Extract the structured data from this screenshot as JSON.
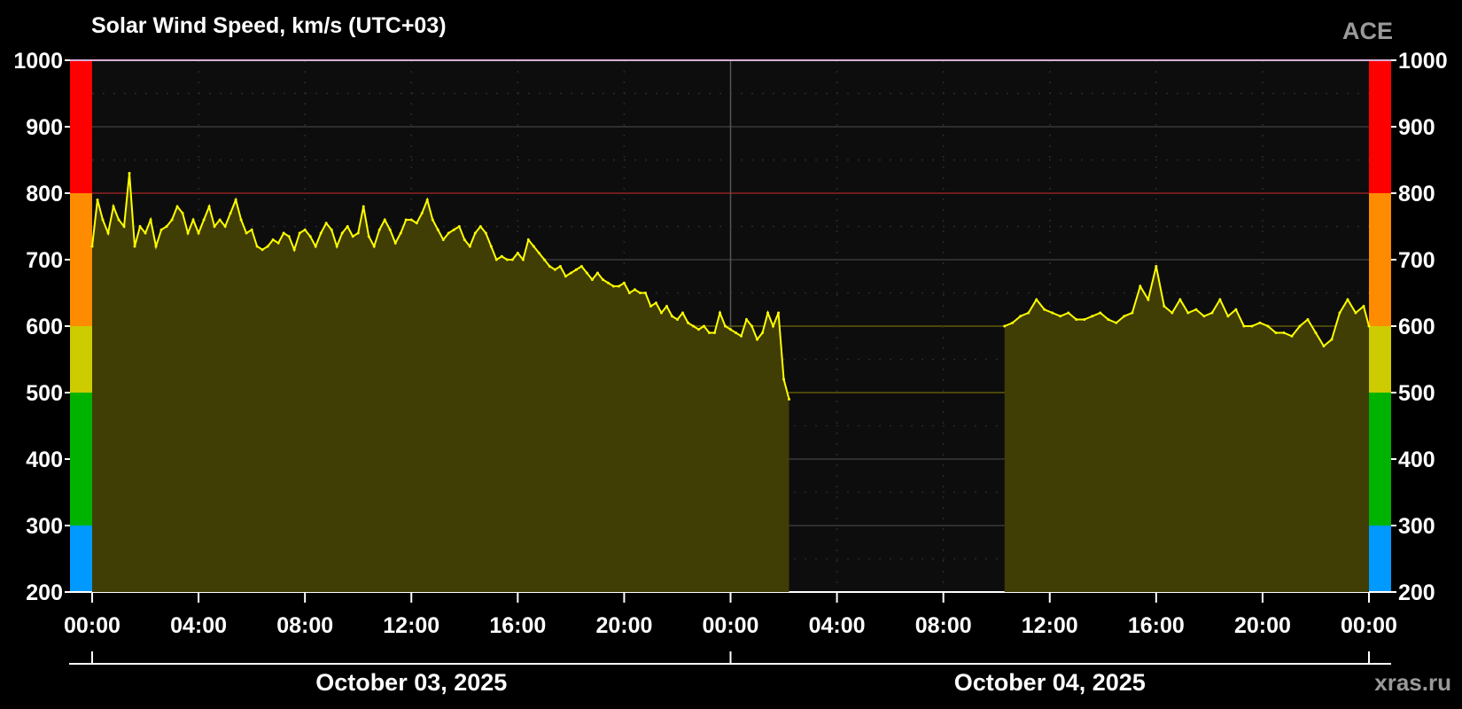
{
  "title": "Solar Wind Speed, km/s (UTC+03)",
  "source_label": "ACE",
  "watermark": "xras.ru",
  "colors": {
    "background": "#000000",
    "plot_bg": "#0d0d0d",
    "grid": "#3a3a3a",
    "line": "#ffff00",
    "fill": "#403d05",
    "band_blue": "#0099ff",
    "band_green": "#00b300",
    "band_olive": "#cccc00",
    "band_orange": "#ff8c00",
    "band_red": "#ff0000"
  },
  "chart_data": {
    "type": "area",
    "title": "Solar Wind Speed, km/s (UTC+03)",
    "x_unit": "hours since October 03, 2025 00:00 (UTC+03)",
    "xlim": [
      0,
      48
    ],
    "ylim": [
      200,
      1000
    ],
    "y_ticks": [
      "200",
      "300",
      "400",
      "500",
      "600",
      "700",
      "800",
      "900",
      "1000"
    ],
    "x_tick_labels": [
      "00:00",
      "04:00",
      "08:00",
      "12:00",
      "16:00",
      "20:00",
      "00:00",
      "04:00",
      "08:00",
      "12:00",
      "16:00",
      "20:00",
      "00:00"
    ],
    "date_labels": [
      "October 03, 2025",
      "October 04, 2025"
    ],
    "threshold_bands": [
      {
        "from": 200,
        "to": 300,
        "color": "#0099ff"
      },
      {
        "from": 300,
        "to": 500,
        "color": "#00b300"
      },
      {
        "from": 500,
        "to": 600,
        "color": "#cccc00"
      },
      {
        "from": 600,
        "to": 800,
        "color": "#ff8c00"
      },
      {
        "from": 800,
        "to": 1000,
        "color": "#ff0000"
      }
    ],
    "series": [
      {
        "color": "#ffff00",
        "segments": [
          {
            "x": [
              0.0,
              0.2,
              0.4,
              0.6,
              0.8,
              1.0,
              1.2,
              1.4,
              1.6,
              1.8,
              2.0,
              2.2,
              2.4,
              2.6,
              2.8,
              3.0,
              3.2,
              3.4,
              3.6,
              3.8,
              4.0,
              4.2,
              4.4,
              4.6,
              4.8,
              5.0,
              5.2,
              5.4,
              5.6,
              5.8,
              6.0,
              6.2,
              6.4,
              6.6,
              6.8,
              7.0,
              7.2,
              7.4,
              7.6,
              7.8,
              8.0,
              8.2,
              8.4,
              8.6,
              8.8,
              9.0,
              9.2,
              9.4,
              9.6,
              9.8,
              10.0,
              10.2,
              10.4,
              10.6,
              10.8,
              11.0,
              11.2,
              11.4,
              11.6,
              11.8,
              12.0,
              12.2,
              12.4,
              12.6,
              12.8,
              13.0,
              13.2,
              13.4,
              13.6,
              13.8,
              14.0,
              14.2,
              14.4,
              14.6,
              14.8,
              15.0,
              15.2,
              15.4,
              15.6,
              15.8,
              16.0,
              16.2,
              16.4,
              16.6,
              16.8,
              17.0,
              17.2,
              17.4,
              17.6,
              17.8,
              18.0,
              18.2,
              18.4,
              18.6,
              18.8,
              19.0,
              19.2,
              19.4,
              19.6,
              19.8,
              20.0,
              20.2,
              20.4,
              20.6,
              20.8,
              21.0,
              21.2,
              21.4,
              21.6,
              21.8,
              22.0,
              22.2,
              22.4,
              22.6,
              22.8,
              23.0,
              23.2,
              23.4,
              23.6,
              23.8,
              24.0,
              24.2,
              24.4,
              24.6,
              24.8,
              25.0,
              25.2,
              25.4,
              25.6,
              25.8,
              26.0,
              26.2
            ],
            "y": [
              720,
              790,
              760,
              740,
              780,
              760,
              750,
              830,
              720,
              750,
              740,
              760,
              720,
              745,
              750,
              760,
              780,
              770,
              740,
              760,
              740,
              760,
              780,
              750,
              760,
              750,
              770,
              790,
              760,
              740,
              745,
              720,
              715,
              720,
              730,
              725,
              740,
              735,
              715,
              740,
              745,
              735,
              720,
              740,
              755,
              745,
              720,
              740,
              750,
              735,
              740,
              780,
              735,
              720,
              745,
              760,
              745,
              725,
              740,
              760,
              760,
              755,
              770,
              790,
              760,
              745,
              730,
              740,
              745,
              750,
              730,
              720,
              740,
              750,
              740,
              720,
              700,
              705,
              700,
              700,
              710,
              700,
              730,
              720,
              710,
              700,
              690,
              685,
              690,
              675,
              680,
              685,
              690,
              680,
              670,
              680,
              670,
              665,
              660,
              660,
              665,
              650,
              655,
              650,
              650,
              630,
              635,
              620,
              630,
              615,
              610,
              620,
              605,
              600,
              595,
              600,
              590,
              590,
              620,
              600,
              595,
              590,
              585,
              610,
              600,
              580,
              590,
              620,
              600,
              620,
              520,
              490
            ]
          },
          {
            "x": [
              34.3,
              34.6,
              34.9,
              35.2,
              35.5,
              35.8,
              36.1,
              36.4,
              36.7,
              37.0,
              37.3,
              37.6,
              37.9,
              38.2,
              38.5,
              38.8,
              39.1,
              39.4,
              39.7,
              40.0,
              40.3,
              40.6,
              40.9,
              41.2,
              41.5,
              41.8,
              42.1,
              42.4,
              42.7,
              43.0,
              43.3,
              43.6,
              43.9,
              44.2,
              44.5,
              44.8,
              45.1,
              45.4,
              45.7,
              46.0,
              46.3,
              46.6,
              46.9,
              47.2,
              47.5,
              47.8,
              48.0
            ],
            "y": [
              600,
              605,
              615,
              620,
              640,
              625,
              620,
              615,
              620,
              610,
              610,
              615,
              620,
              610,
              605,
              615,
              620,
              660,
              640,
              690,
              630,
              620,
              640,
              620,
              625,
              615,
              620,
              640,
              615,
              625,
              600,
              600,
              605,
              600,
              590,
              590,
              585,
              600,
              610,
              590,
              570,
              580,
              620,
              640,
              620,
              630,
              600
            ]
          }
        ]
      }
    ]
  }
}
